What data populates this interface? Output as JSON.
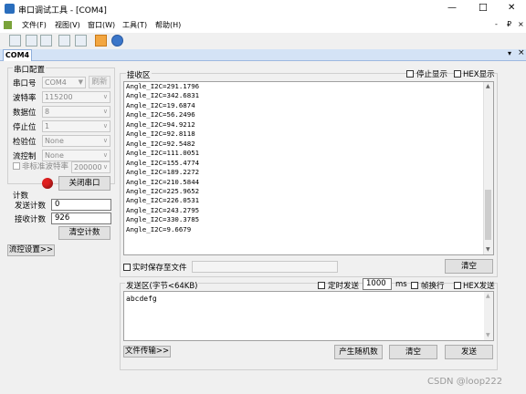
{
  "window": {
    "title": "串口调试工具 - [COM4]",
    "controls": {
      "minimize": "—",
      "maximize": "☐",
      "close": "✕"
    }
  },
  "menu": [
    "文件(F)",
    "视图(V)",
    "窗口(W)",
    "工具(T)",
    "帮助(H)"
  ],
  "menu_right": [
    "-",
    "₽",
    "×"
  ],
  "toolbar": {
    "icons": [
      "menu-grip-icon",
      "window-icon",
      "split-icon",
      "panels-icon",
      "image-icon",
      "doc-icon",
      "upload-icon",
      "help-icon"
    ]
  },
  "tab": {
    "label": "COM4",
    "pin": "▾",
    "close": "×"
  },
  "serial": {
    "group_title": "串口配置",
    "port_label": "串口号",
    "port_value": "COM4",
    "refresh": "刷新",
    "baud_label": "波特率",
    "baud_value": "115200",
    "data_label": "数据位",
    "data_value": "8",
    "stop_label": "停止位",
    "stop_value": "1",
    "parity_label": "检验位",
    "parity_value": "None",
    "flow_label": "流控制",
    "flow_value": "None",
    "nonstd_label": "非标准波特率",
    "nonstd_value": "200000",
    "close_port": "关闭串口",
    "status_color": "#e02020"
  },
  "counts": {
    "title": "计数",
    "sent_label": "发送计数",
    "sent_value": "0",
    "recv_label": "接收计数",
    "recv_value": "926",
    "clear": "清空计数"
  },
  "flow_settings": "流控设置>>",
  "receive": {
    "title": "接收区",
    "stop_display": "停止显示",
    "hex_display": "HEX显示",
    "lines": [
      "Angle_I2C=291.1796",
      "Angle_I2C=342.6831",
      "Angle_I2C=19.6874",
      "Angle_I2C=56.2496",
      "Angle_I2C=94.9212",
      "Angle_I2C=92.8118",
      "Angle_I2C=92.5482",
      "Angle_I2C=111.0051",
      "Angle_I2C=155.4774",
      "Angle_I2C=189.2272",
      "Angle_I2C=210.5844",
      "Angle_I2C=225.9652",
      "Angle_I2C=226.0531",
      "Angle_I2C=243.2795",
      "Angle_I2C=330.3785",
      "Angle_I2C=9.6679"
    ],
    "realtime_save": "实时保存至文件",
    "clear": "清空"
  },
  "send": {
    "title": "发送区(字节<64KB)",
    "timed_send": "定时发送",
    "interval": "1000",
    "unit": "ms",
    "newline": "帧换行",
    "hex_send": "HEX发送",
    "content": "abcdefg",
    "file_transfer": "文件传输>>",
    "random": "产生随机数",
    "clear": "清空",
    "send": "发送"
  },
  "watermark": "CSDN @loop222"
}
